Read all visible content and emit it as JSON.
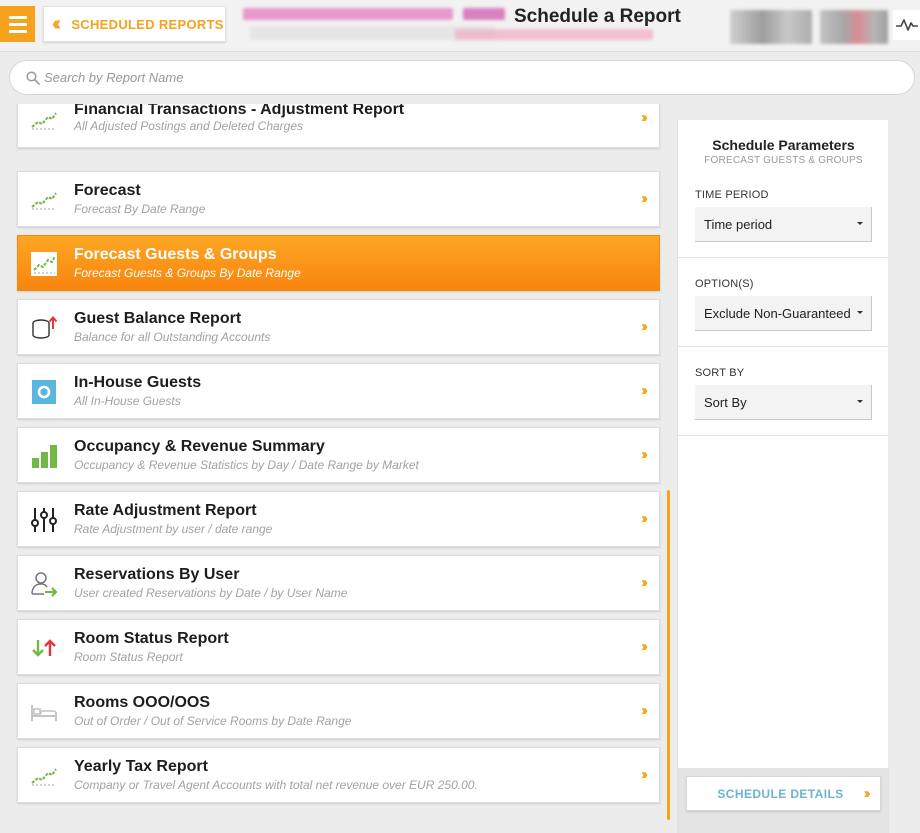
{
  "header": {
    "back_label": "SCHEDULED REPORTS",
    "title": "Schedule a Report",
    "icons": {
      "menu": "hamburger-icon",
      "back": "double-chevron-left-icon",
      "activity": "pulse-icon"
    }
  },
  "search": {
    "placeholder": "Search by Report Name",
    "icon": "search-icon"
  },
  "reports": [
    {
      "title": "Financial Transactions - Adjustment Report",
      "subtitle": "All Adjusted Postings and Deleted Charges",
      "icon": "trend-chart-icon"
    },
    {
      "title": "Forecast",
      "subtitle": "Forecast By Date Range",
      "icon": "trend-chart-icon"
    },
    {
      "title": "Forecast Guests & Groups",
      "subtitle": "Forecast Guests & Groups By Date Range",
      "icon": "trend-chart-icon",
      "active": true
    },
    {
      "title": "Guest Balance Report",
      "subtitle": "Balance for all Outstanding Accounts",
      "icon": "coins-stack-icon"
    },
    {
      "title": "In-House Guests",
      "subtitle": "All In-House Guests",
      "icon": "in-house-icon"
    },
    {
      "title": "Occupancy & Revenue Summary",
      "subtitle": "Occupancy & Revenue Statistics by Day / Date Range by Market",
      "icon": "bar-chart-icon"
    },
    {
      "title": "Rate Adjustment Report",
      "subtitle": "Rate Adjustment by user / date range",
      "icon": "sliders-icon"
    },
    {
      "title": "Reservations By User",
      "subtitle": "User created Reservations by Date / by User Name",
      "icon": "user-arrow-icon"
    },
    {
      "title": "Room Status Report",
      "subtitle": "Room Status Report",
      "icon": "up-down-arrows-icon"
    },
    {
      "title": "Rooms OOO/OOS",
      "subtitle": "Out of Order / Out of Service Rooms by Date Range",
      "icon": "bed-icon"
    },
    {
      "title": "Yearly Tax Report",
      "subtitle": "Company or Travel Agent Accounts with total net revenue over EUR 250.00.",
      "icon": "trend-chart-icon"
    }
  ],
  "panel": {
    "title": "Schedule Parameters",
    "subtitle": "FORECAST GUESTS & GROUPS",
    "fields": [
      {
        "label": "TIME PERIOD",
        "value": "Time period"
      },
      {
        "label": "OPTION(S)",
        "value": "Exclude Non-Guaranteed"
      },
      {
        "label": "SORT BY",
        "value": "Sort By"
      }
    ],
    "button_label": "SCHEDULE DETAILS"
  },
  "colors": {
    "accent": "#f7a21c",
    "active_row": "#fc9b1d",
    "green": "#72b844",
    "red": "#e8353a",
    "blue": "#6bb4d2"
  }
}
